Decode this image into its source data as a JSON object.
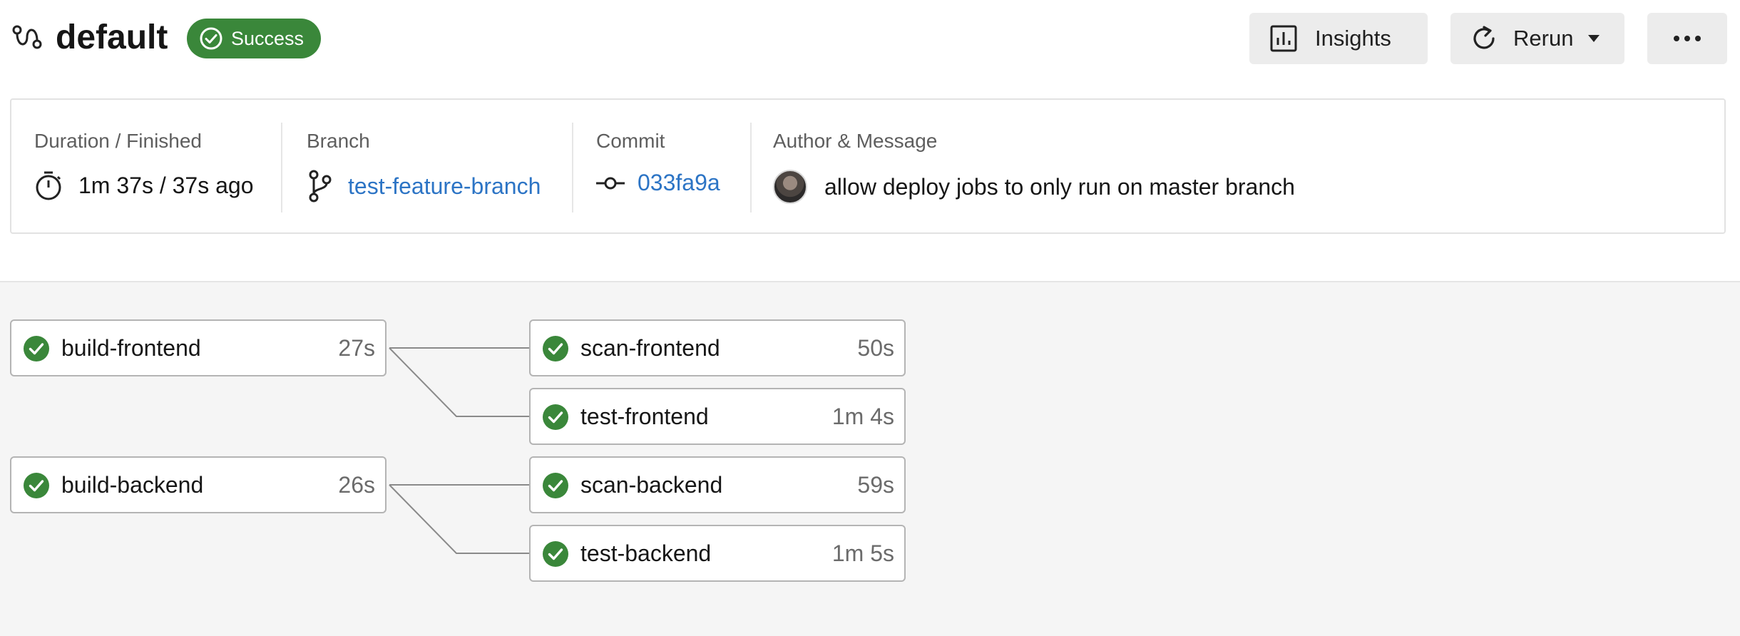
{
  "header": {
    "title": "default",
    "status": "Success",
    "insights_label": "Insights",
    "rerun_label": "Rerun"
  },
  "info": {
    "duration_label": "Duration / Finished",
    "duration_value": "1m 37s / 37s ago",
    "branch_label": "Branch",
    "branch_value": "test-feature-branch",
    "commit_label": "Commit",
    "commit_value": "033fa9a",
    "author_label": "Author & Message",
    "message": "allow deploy jobs to only run on master branch"
  },
  "jobs": [
    {
      "name": "build-frontend",
      "duration": "27s",
      "status": "success"
    },
    {
      "name": "scan-frontend",
      "duration": "50s",
      "status": "success"
    },
    {
      "name": "test-frontend",
      "duration": "1m 4s",
      "status": "success"
    },
    {
      "name": "build-backend",
      "duration": "26s",
      "status": "success"
    },
    {
      "name": "scan-backend",
      "duration": "59s",
      "status": "success"
    },
    {
      "name": "test-backend",
      "duration": "1m 5s",
      "status": "success"
    }
  ],
  "icons": {
    "workflow": "workflow-icon",
    "status": "check-circle-icon",
    "insights": "bar-chart-icon",
    "rerun": "refresh-icon",
    "rerun_menu": "caret-down-icon",
    "more": "more-horizontal-icon",
    "duration": "stopwatch-icon",
    "branch": "git-branch-icon",
    "commit": "git-commit-icon"
  },
  "colors": {
    "success": "#3a873a",
    "link": "#2c74c5",
    "pipeline_bg": "#f5f5f5"
  }
}
